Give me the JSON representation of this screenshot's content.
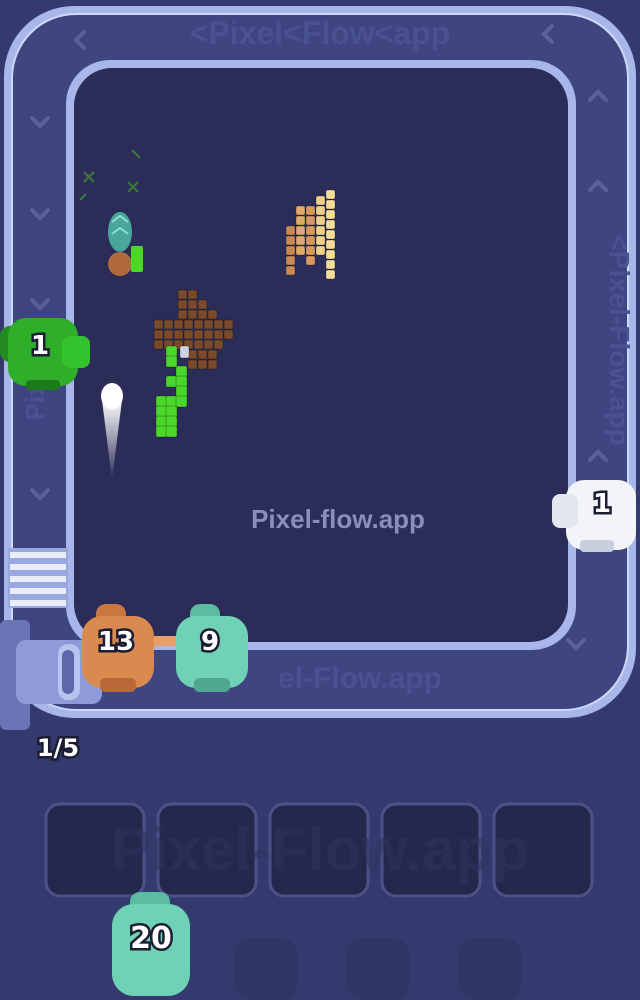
{
  "watermarks": {
    "top": "<Pixel<Flow<app",
    "right": "<Pixel-Flow.app",
    "bottom_track": "el-Flow.app",
    "center": "Pixel-flow.app",
    "tray": "Pixel-Flow.app"
  },
  "conveyor": {
    "capacity_label": "1/5"
  },
  "shooters": [
    {
      "id": "green-left",
      "count": "1",
      "color": "#2fae2a"
    },
    {
      "id": "white-right",
      "count": "1",
      "color": "#f2f4f8"
    },
    {
      "id": "orange-gate",
      "count": "13",
      "color": "#d98a4e"
    },
    {
      "id": "teal-gate",
      "count": "9",
      "color": "#6fd1b5"
    },
    {
      "id": "teal-queue",
      "count": "20",
      "color": "#6fd1b5"
    }
  ],
  "tray": {
    "slot_count": 5
  },
  "colors": {
    "background": "#343a6e",
    "board": "#2b2d58",
    "track": "#9eaee4",
    "brown_pixels": "#7a4a2a",
    "green_pixels": "#4bd62a",
    "tan_pixels": "#e8c384"
  }
}
